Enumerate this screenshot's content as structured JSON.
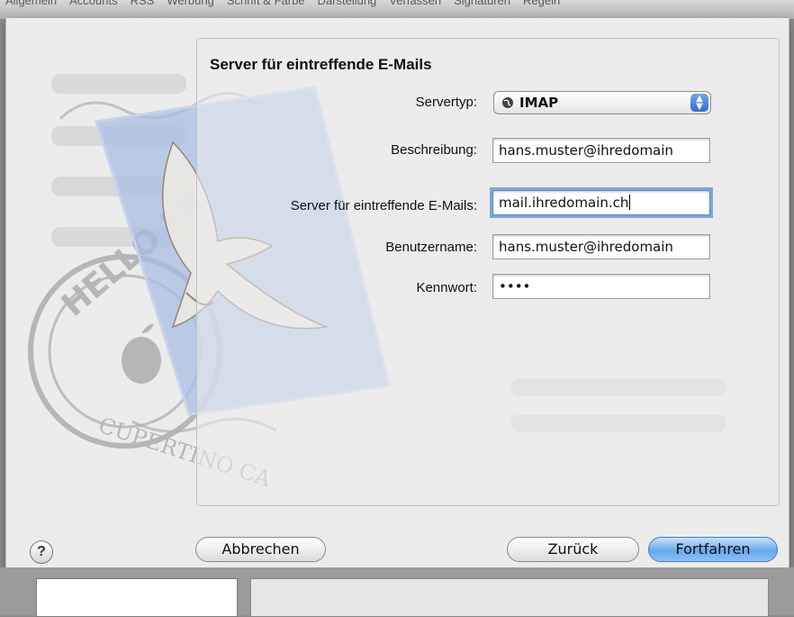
{
  "toolbar": {
    "tabs": [
      "Allgemein",
      "Accounts",
      "RSS",
      "Werbung",
      "Schrift & Farbe",
      "Darstellung",
      "Verfassen",
      "Signaturen",
      "Regeln"
    ]
  },
  "dialog": {
    "heading": "Server für eintreffende E-Mails",
    "servertype": {
      "label": "Servertyp:",
      "value": "IMAP",
      "icon": "globe-icon"
    },
    "description": {
      "label": "Beschreibung:",
      "value": "hans.muster@ihredomain"
    },
    "incoming_server": {
      "label": "Server für eintreffende E-Mails:",
      "value": "mail.ihredomain.ch"
    },
    "username": {
      "label": "Benutzername:",
      "value": "hans.muster@ihredomain"
    },
    "password": {
      "label": "Kennwort:",
      "value": "••••"
    }
  },
  "buttons": {
    "help": "?",
    "cancel": "Abbrechen",
    "back": "Zurück",
    "continue": "Fortfahren"
  },
  "colors": {
    "accent": "#6aa8ee",
    "focus_ring": "#7aa7dc"
  }
}
